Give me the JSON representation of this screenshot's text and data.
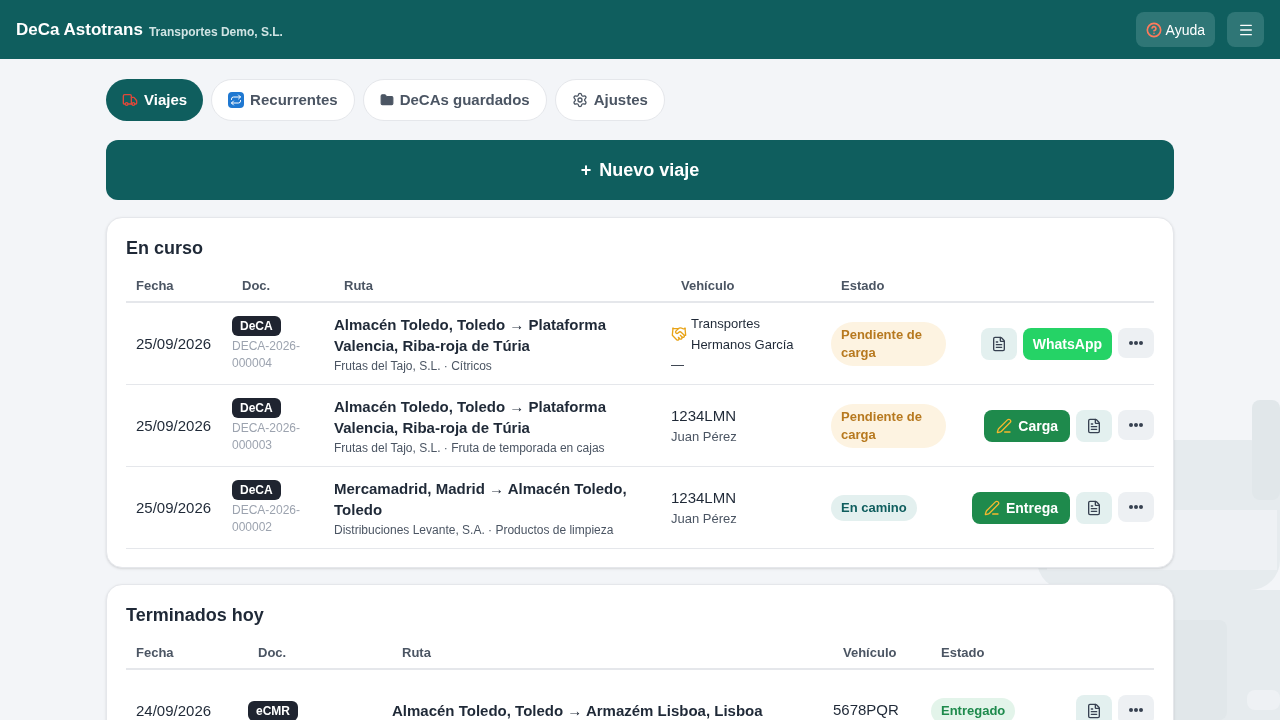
{
  "header": {
    "brand": "DeCa Astotrans",
    "company": "Transportes Demo, S.L.",
    "help": "Ayuda"
  },
  "tabs": [
    {
      "label": "Viajes",
      "selected": true
    },
    {
      "label": "Recurrentes",
      "selected": false
    },
    {
      "label": "DeCAs guardados",
      "selected": false
    },
    {
      "label": "Ajustes",
      "selected": false
    }
  ],
  "new_trip": {
    "icon": "+",
    "label": "Nuevo viaje"
  },
  "sections": [
    {
      "title": "En curso",
      "columns": [
        "Fecha",
        "Doc.",
        "Ruta",
        "Vehículo",
        "Estado"
      ],
      "rows": [
        {
          "date": "25/09/2026",
          "doc_type": "DeCA",
          "doc_number": "DECA-2026-000004",
          "route": "Almacén Toledo, Toledo → Plataforma Valencia, Riba-roja de Túria",
          "detail": "Frutas del Tajo, S.L. · Cítricos",
          "vehicle": {
            "kind": "carrier",
            "main": "Transportes Hermanos García",
            "sub": "—"
          },
          "status": {
            "kind": "pending",
            "label": "Pendiente de carga"
          },
          "actions": [
            {
              "kind": "doc"
            },
            {
              "kind": "whatsapp",
              "label": "WhatsApp"
            },
            {
              "kind": "more"
            }
          ]
        },
        {
          "date": "25/09/2026",
          "doc_type": "DeCA",
          "doc_number": "DECA-2026-000003",
          "route": "Almacén Toledo, Toledo → Plataforma Valencia, Riba-roja de Túria",
          "detail": "Frutas del Tajo, S.L. · Fruta de temporada en cajas",
          "vehicle": {
            "kind": "plate",
            "main": "1234LMN",
            "sub": "Juan Pérez"
          },
          "status": {
            "kind": "pending",
            "label": "Pendiente de carga"
          },
          "actions": [
            {
              "kind": "sign",
              "label": "Carga"
            },
            {
              "kind": "doc"
            },
            {
              "kind": "more"
            }
          ]
        },
        {
          "date": "25/09/2026",
          "doc_type": "DeCA",
          "doc_number": "DECA-2026-000002",
          "route": "Mercamadrid, Madrid → Almacén Toledo, Toledo",
          "detail": "Distribuciones Levante, S.A. · Productos de limpieza",
          "vehicle": {
            "kind": "plate",
            "main": "1234LMN",
            "sub": "Juan Pérez"
          },
          "status": {
            "kind": "transit",
            "label": "En camino"
          },
          "actions": [
            {
              "kind": "sign",
              "label": "Entrega"
            },
            {
              "kind": "doc"
            },
            {
              "kind": "more"
            }
          ]
        }
      ]
    },
    {
      "title": "Terminados hoy",
      "columns": [
        "Fecha",
        "Doc.",
        "Ruta",
        "Vehículo",
        "Estado"
      ],
      "rows": [
        {
          "date": "24/09/2026",
          "doc_type": "eCMR",
          "route": "Almacén Toledo, Toledo → Armazém Lisboa, Lisboa",
          "vehicle": {
            "kind": "plate",
            "main": "5678PQR"
          },
          "status": {
            "kind": "delivered",
            "label": "Entregado"
          },
          "actions": [
            {
              "kind": "doc"
            },
            {
              "kind": "more"
            }
          ]
        }
      ]
    }
  ]
}
